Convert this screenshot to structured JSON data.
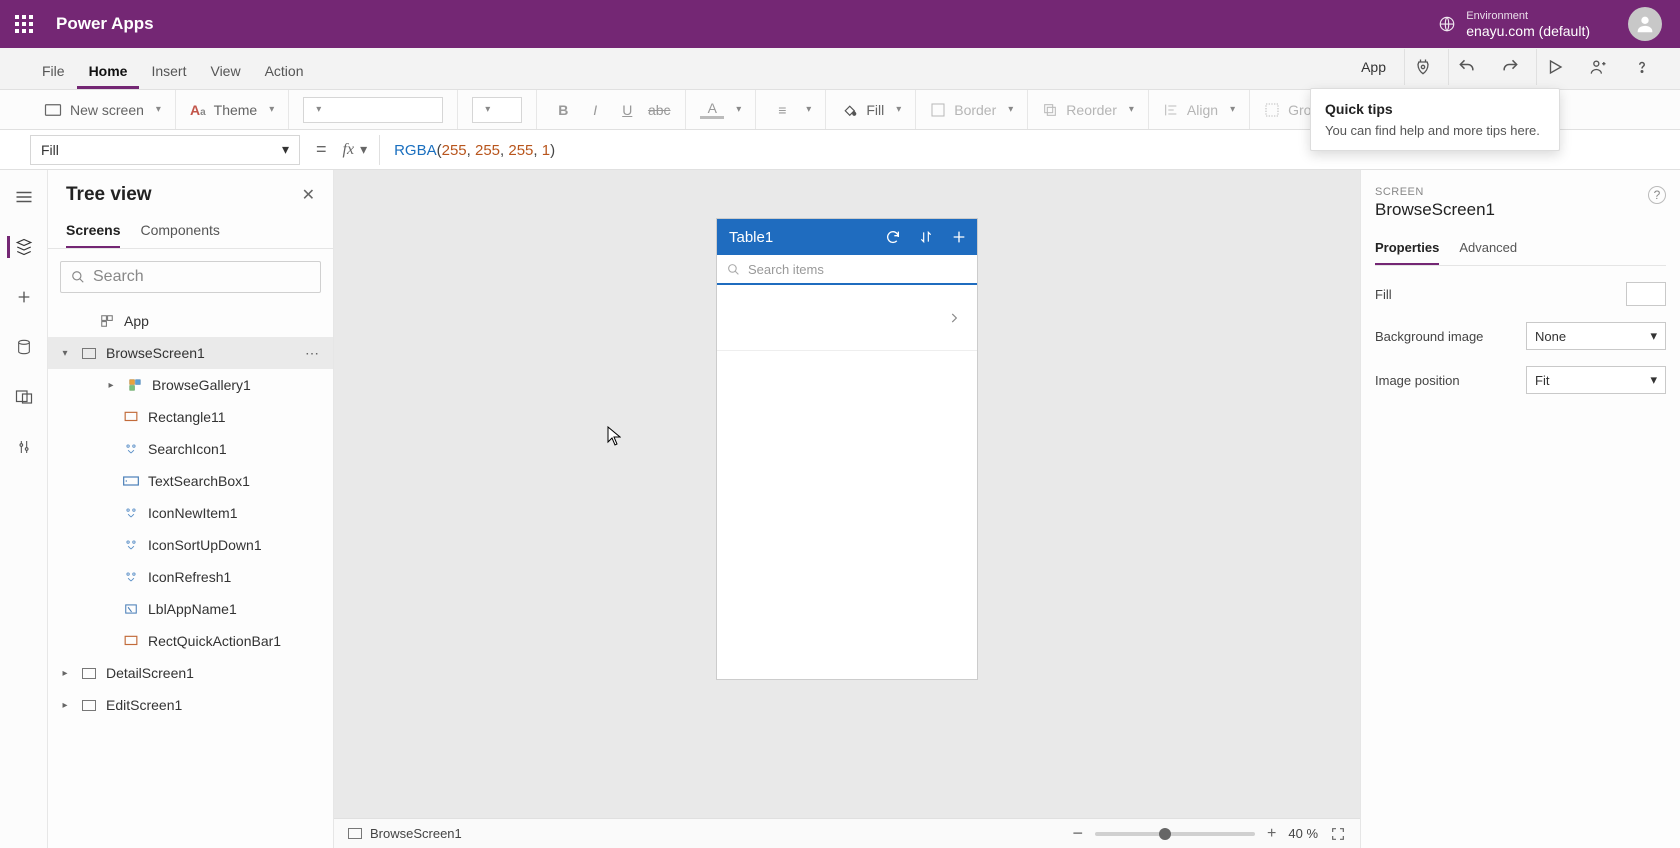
{
  "header": {
    "app_title": "Power Apps",
    "env_label": "Environment",
    "env_name": "enayu.com (default)"
  },
  "ribbon": {
    "tabs": [
      "File",
      "Home",
      "Insert",
      "View",
      "Action"
    ],
    "active_tab": 1,
    "app_link": "App"
  },
  "toolbar": {
    "new_screen": "New screen",
    "theme": "Theme",
    "fill": "Fill",
    "border": "Border",
    "reorder": "Reorder",
    "align": "Align",
    "group": "Group"
  },
  "formula_bar": {
    "property": "Fill",
    "fx": "fx",
    "fn": "RGBA",
    "args": [
      "255",
      "255",
      "255",
      "1"
    ]
  },
  "tree": {
    "title": "Tree view",
    "tabs": [
      "Screens",
      "Components"
    ],
    "active_tab": 0,
    "search_placeholder": "Search",
    "items": [
      {
        "label": "App",
        "icon": "app"
      },
      {
        "label": "BrowseScreen1",
        "icon": "screen",
        "selected": true,
        "expanded": true,
        "children": [
          {
            "label": "BrowseGallery1",
            "icon": "gallery",
            "expanded": false
          },
          {
            "label": "Rectangle11",
            "icon": "rect"
          },
          {
            "label": "SearchIcon1",
            "icon": "iconctl"
          },
          {
            "label": "TextSearchBox1",
            "icon": "textbox"
          },
          {
            "label": "IconNewItem1",
            "icon": "iconctl"
          },
          {
            "label": "IconSortUpDown1",
            "icon": "iconctl"
          },
          {
            "label": "IconRefresh1",
            "icon": "iconctl"
          },
          {
            "label": "LblAppName1",
            "icon": "label"
          },
          {
            "label": "RectQuickActionBar1",
            "icon": "rect"
          }
        ]
      },
      {
        "label": "DetailScreen1",
        "icon": "screen",
        "expanded": false
      },
      {
        "label": "EditScreen1",
        "icon": "screen",
        "expanded": false
      }
    ]
  },
  "canvas": {
    "phone_title": "Table1",
    "search_placeholder": "Search items",
    "status_screen": "BrowseScreen1",
    "zoom_value": "40",
    "zoom_suffix": "%"
  },
  "props": {
    "kicker": "SCREEN",
    "title": "BrowseScreen1",
    "tabs": [
      "Properties",
      "Advanced"
    ],
    "active_tab": 0,
    "rows": {
      "fill_label": "Fill",
      "bgimg_label": "Background image",
      "bgimg_value": "None",
      "imgpos_label": "Image position",
      "imgpos_value": "Fit"
    }
  },
  "tips": {
    "title": "Quick tips",
    "body": "You can find help and more tips here."
  }
}
